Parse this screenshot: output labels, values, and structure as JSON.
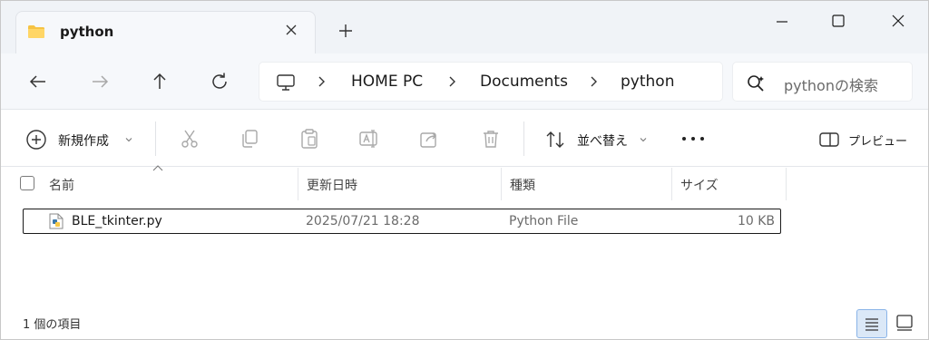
{
  "tab": {
    "title": "python",
    "close_icon": "close-icon",
    "new_tab_label": "+"
  },
  "window_controls": {
    "minimize": "minimize-icon",
    "maximize": "maximize-icon",
    "close": "close-icon"
  },
  "nav": {
    "back": "back-arrow-icon",
    "forward": "forward-arrow-icon",
    "up": "up-arrow-icon",
    "refresh": "refresh-icon"
  },
  "address": {
    "breadcrumbs": [
      "HOME PC",
      "Documents",
      "python"
    ],
    "separator": ">"
  },
  "search": {
    "placeholder": "pythonの検索"
  },
  "toolbar": {
    "new_label": "新規作成",
    "sort_label": "並べ替え",
    "more_label": "•••",
    "preview_label": "プレビュー"
  },
  "columns": {
    "name": "名前",
    "modified": "更新日時",
    "type": "種類",
    "size": "サイズ"
  },
  "files": [
    {
      "name": "BLE_tkinter.py",
      "modified": "2025/07/21 18:28",
      "type": "Python File",
      "size": "10 KB"
    }
  ],
  "status": {
    "item_count": "1 個の項目"
  },
  "colors": {
    "titlebar_bg": "#f0f3f7",
    "accent": "#0067c0",
    "folder_yellow": "#f6c343",
    "disabled_icon": "#a8a8a8"
  }
}
